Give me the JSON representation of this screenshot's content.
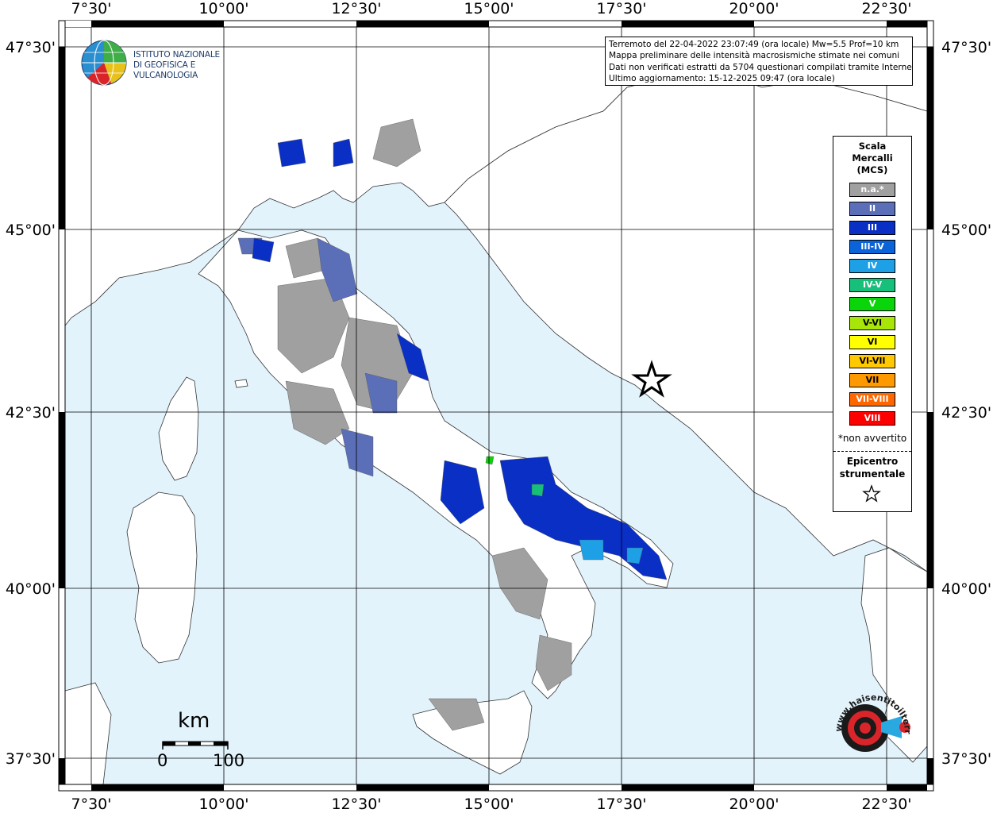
{
  "coordinates": {
    "lon_labels": [
      "7°30'",
      "10°00'",
      "12°30'",
      "15°00'",
      "17°30'",
      "20°00'",
      "22°30'"
    ],
    "lat_labels": [
      "47°30'",
      "45°00'",
      "42°30'",
      "40°00'",
      "37°30'"
    ]
  },
  "info": {
    "line1": "Terremoto del 22-04-2022 23:07:49 (ora locale) Mw=5.5 Prof=10 km",
    "line2": "Mappa preliminare delle intensità macrosismiche stimate nei comuni",
    "line3": "Dati non verificati estratti da 5704 questionari compilati tramite Internet.",
    "line4": "Ultimo aggiornamento: 15-12-2025 09:47 (ora locale)"
  },
  "logo": {
    "line1": "ISTITUTO NAZIONALE",
    "line2": "DI GEOFISICA E VULCANOLOGIA"
  },
  "legend": {
    "title1": "Scala",
    "title2": "Mercalli",
    "title3": "(MCS)",
    "items": [
      {
        "label": "n.a.*",
        "color": "#a0a0a0"
      },
      {
        "label": "II",
        "color": "#5b6fb8"
      },
      {
        "label": "III",
        "color": "#0a2fc4"
      },
      {
        "label": "III-IV",
        "color": "#0a63d9"
      },
      {
        "label": "IV",
        "color": "#1ea0e6"
      },
      {
        "label": "IV-V",
        "color": "#16c07a"
      },
      {
        "label": "V",
        "color": "#0ad40a"
      },
      {
        "label": "V-VI",
        "color": "#a8e60a"
      },
      {
        "label": "VI",
        "color": "#ffff00"
      },
      {
        "label": "VI-VII",
        "color": "#ffc800"
      },
      {
        "label": "VII",
        "color": "#ff9900"
      },
      {
        "label": "VII-VIII",
        "color": "#ff6600"
      },
      {
        "label": "VIII",
        "color": "#ff0000"
      }
    ],
    "note": "*non avvertito",
    "epi1": "Epicentro",
    "epi2": "strumentale"
  },
  "scale": {
    "unit": "km",
    "zero": "0",
    "max": "100"
  },
  "badge": {
    "text": "www.haisentitoilterremoto.it"
  }
}
